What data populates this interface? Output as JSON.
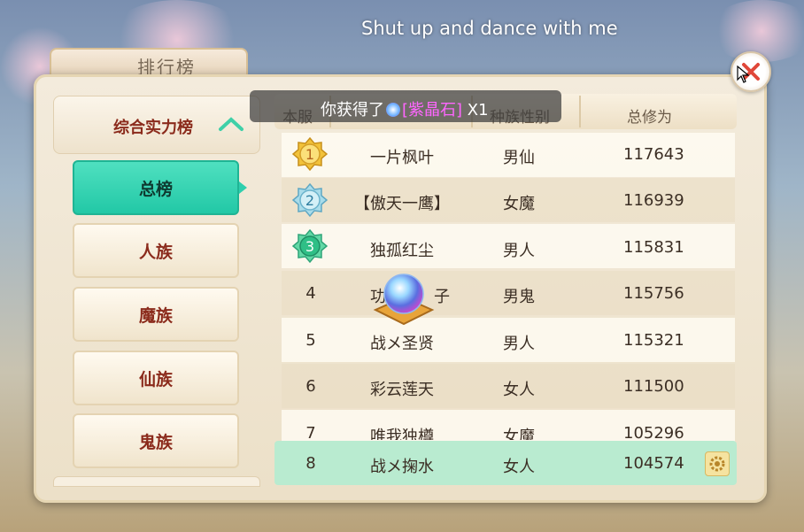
{
  "song_caption": "Shut up and dance with me",
  "window": {
    "title": "排行榜"
  },
  "category": {
    "label": "综合实力榜"
  },
  "nav": [
    {
      "label": "总榜",
      "active": true
    },
    {
      "label": "人族",
      "active": false
    },
    {
      "label": "魔族",
      "active": false
    },
    {
      "label": "仙族",
      "active": false
    },
    {
      "label": "鬼族",
      "active": false
    }
  ],
  "table": {
    "headers": [
      "本服",
      "",
      "种族性别",
      "总修为"
    ],
    "rows": [
      {
        "rank": "1",
        "name": "一片枫叶",
        "race": "男仙",
        "score": "117643",
        "medal": "gold"
      },
      {
        "rank": "2",
        "name": "【傲天一鹰】",
        "race": "女魔",
        "score": "116939",
        "medal": "silver"
      },
      {
        "rank": "3",
        "name": "独孤红尘",
        "race": "男人",
        "score": "115831",
        "medal": "green"
      },
      {
        "rank": "4",
        "name": "功",
        "name_tail": "子",
        "race": "男鬼",
        "score": "115756"
      },
      {
        "rank": "5",
        "name": "战メ圣贤",
        "race": "男人",
        "score": "115321"
      },
      {
        "rank": "6",
        "name": "彩云莲天",
        "race": "女人",
        "score": "111500"
      },
      {
        "rank": "7",
        "name": "唯我独樽",
        "race": "女魔",
        "score": "105296"
      }
    ],
    "my_row": {
      "rank": "8",
      "name": "战メ掬水",
      "race": "女人",
      "score": "104574"
    }
  },
  "toast": {
    "prefix": "你获得了",
    "item": "[紫晶石]",
    "count": "X1"
  },
  "colors": {
    "accent": "#2ecfae",
    "category_text": "#8b2b1c",
    "my_row": "#b9ebd0"
  },
  "icons": [
    "close-icon",
    "chevron-up-icon",
    "gear-icon",
    "gold-medal-icon",
    "silver-medal-icon",
    "green-medal-icon",
    "crystal-orb-icon",
    "cursor-icon"
  ]
}
